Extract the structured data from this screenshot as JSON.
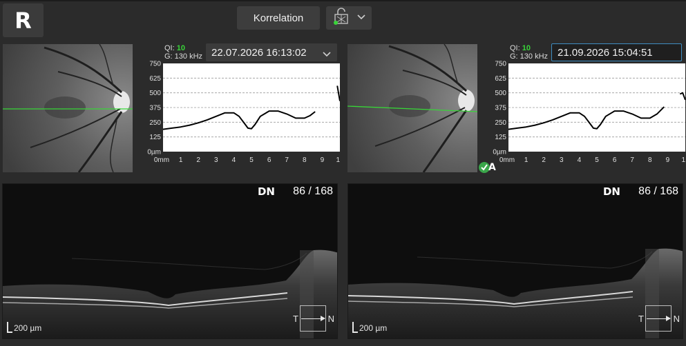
{
  "header": {
    "eye": "R",
    "correlation_label": "Korrelation",
    "lock_icon": "lock-grid-icon",
    "dropdown_icon": "chevron-down-icon"
  },
  "panels": [
    {
      "qi_label": "QI:",
      "qi_value": "10",
      "g_label": "G: 130 kHz",
      "date": "22.07.2026 16:13:02",
      "bscan": {
        "dn": "DN",
        "slice": "86 / 168",
        "scale": "200 µm",
        "orient_t": "T",
        "orient_n": "N"
      }
    },
    {
      "qi_label": "QI:",
      "qi_value": "10",
      "g_label": "G: 130 kHz",
      "date": "21.09.2026 15:04:51",
      "approved_label": "A",
      "bscan": {
        "dn": "DN",
        "slice": "86 / 168",
        "scale": "200 µm",
        "orient_t": "T",
        "orient_n": "N"
      }
    }
  ],
  "chart_data": [
    {
      "type": "line",
      "y_tick_labels": [
        "0µm",
        "125",
        "250",
        "375",
        "500",
        "625",
        "750"
      ],
      "x_tick_labels": [
        "0mm",
        "1",
        "2",
        "3",
        "4",
        "5",
        "6",
        "7",
        "8",
        "9",
        "10"
      ],
      "xlim": [
        0,
        10
      ],
      "ylim": [
        0,
        750
      ],
      "grid": true,
      "series": [
        {
          "x": [
            0,
            0.5,
            1,
            1.5,
            2,
            2.5,
            3,
            3.5,
            4,
            4.3,
            4.6,
            4.8,
            5,
            5.2,
            5.5,
            6,
            6.5,
            7,
            7.5,
            8,
            8.3,
            8.6
          ],
          "y": [
            190,
            200,
            210,
            225,
            245,
            270,
            300,
            330,
            330,
            300,
            240,
            200,
            195,
            230,
            300,
            345,
            345,
            320,
            285,
            285,
            305,
            340
          ]
        },
        {
          "x": [
            9.85,
            10
          ],
          "y": [
            560,
            430
          ]
        }
      ]
    },
    {
      "type": "line",
      "y_tick_labels": [
        "0µm",
        "125",
        "250",
        "375",
        "500",
        "625",
        "750"
      ],
      "x_tick_labels": [
        "0mm",
        "1",
        "2",
        "3",
        "4",
        "5",
        "6",
        "7",
        "8",
        "9",
        "10"
      ],
      "xlim": [
        0,
        10
      ],
      "ylim": [
        0,
        750
      ],
      "grid": true,
      "series": [
        {
          "x": [
            0,
            0.5,
            1,
            1.5,
            2,
            2.5,
            3,
            3.5,
            4,
            4.3,
            4.6,
            4.8,
            5,
            5.2,
            5.5,
            6,
            6.5,
            7,
            7.5,
            8,
            8.4,
            8.8
          ],
          "y": [
            190,
            200,
            210,
            225,
            245,
            270,
            300,
            330,
            330,
            300,
            240,
            200,
            195,
            230,
            300,
            345,
            345,
            320,
            285,
            285,
            320,
            380
          ]
        },
        {
          "x": [
            9.7,
            9.85,
            10
          ],
          "y": [
            490,
            500,
            440
          ]
        }
      ]
    }
  ]
}
